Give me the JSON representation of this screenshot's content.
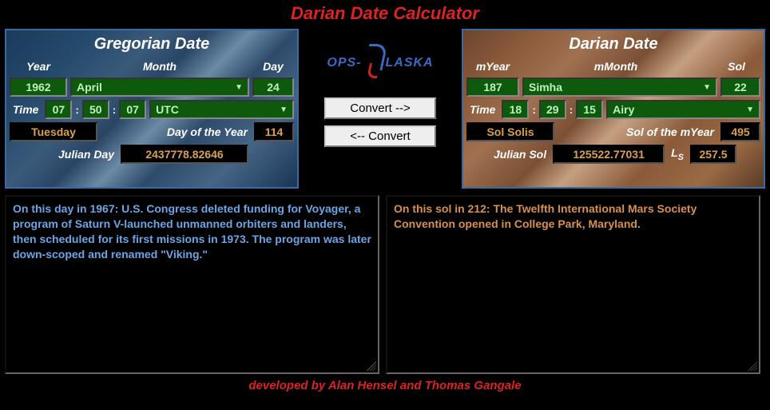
{
  "title": "Darian Date Calculator",
  "footer": "developed by Alan Hensel and Thomas Gangale",
  "logo": {
    "left": "OPS-",
    "right": "LASKA"
  },
  "buttons": {
    "to_darian": "Convert -->",
    "to_gregorian": "<-- Convert"
  },
  "gregorian": {
    "title": "Gregorian Date",
    "labels": {
      "year": "Year",
      "month": "Month",
      "day": "Day",
      "time": "Time",
      "doy": "Day of the Year",
      "jd": "Julian Day"
    },
    "year": "1962",
    "month": "April",
    "day": "24",
    "hh": "07",
    "mm": "50",
    "ss": "07",
    "tz": "UTC",
    "weekday": "Tuesday",
    "doy": "114",
    "jd": "2437778.82646"
  },
  "darian": {
    "title": "Darian Date",
    "labels": {
      "year": "mYear",
      "month": "mMonth",
      "sol": "Sol",
      "time": "Time",
      "soy": "Sol of the mYear",
      "js": "Julian Sol",
      "ls_prefix": "L",
      "ls_sub": "S"
    },
    "myear": "187",
    "mmonth": "Simha",
    "sol": "22",
    "hh": "18",
    "mm": "29",
    "ss": "15",
    "meridian": "Airy",
    "solname": "Sol Solis",
    "soy": "495",
    "js": "125522.77031",
    "ls": "257.5"
  },
  "history_earth": "On this day in 1967: U.S. Congress deleted funding for Voyager, a program of Saturn V-launched unmanned orbiters and landers, then scheduled for its first missions in 1973. The program was later down-scoped and renamed \"Viking.\"",
  "history_mars": "On this sol in 212: The Twelfth International Mars Society Convention opened in College Park, Maryland."
}
